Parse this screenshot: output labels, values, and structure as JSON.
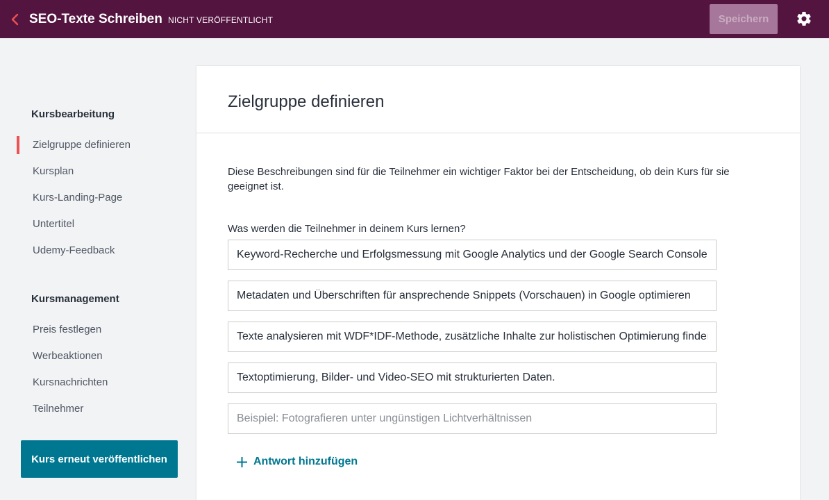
{
  "header": {
    "course_title": "SEO-Texte Schreiben",
    "status": "NICHT VERÖFFENTLICHT",
    "save_label": "Speichern",
    "icons": {
      "back": "chevron-left-icon",
      "settings": "gear-icon"
    },
    "colors": {
      "bar": "#541440",
      "back_arrow": "#ec5252"
    }
  },
  "sidebar": {
    "sections": [
      {
        "title": "Kursbearbeitung",
        "items": [
          {
            "label": "Zielgruppe definieren",
            "active": true
          },
          {
            "label": "Kursplan"
          },
          {
            "label": "Kurs-Landing-Page"
          },
          {
            "label": "Untertitel"
          },
          {
            "label": "Udemy-Feedback"
          }
        ]
      },
      {
        "title": "Kursmanagement",
        "items": [
          {
            "label": "Preis festlegen"
          },
          {
            "label": "Werbeaktionen"
          },
          {
            "label": "Kursnachrichten"
          },
          {
            "label": "Teilnehmer"
          }
        ]
      }
    ],
    "publish_label": "Kurs erneut veröffentlichen",
    "colors": {
      "active_indicator": "#ec5252",
      "publish_button": "#007791"
    }
  },
  "main": {
    "title": "Zielgruppe definieren",
    "description": "Diese Beschreibungen sind für die Teilnehmer ein wichtiger Faktor bei der Entscheidung, ob dein Kurs für sie geeignet ist.",
    "question": "Was werden die Teilnehmer in deinem Kurs lernen?",
    "answers": [
      {
        "value": "Keyword-Recherche und Erfolgsmessung mit Google Analytics und der Google Search Console"
      },
      {
        "value": "Metadaten und Überschriften für ansprechende Snippets (Vorschauen) in Google optimieren"
      },
      {
        "value": "Texte analysieren mit WDF*IDF-Methode, zusätzliche Inhalte zur holistischen Optimierung finden"
      },
      {
        "value": "Textoptimierung, Bilder- und Video-SEO mit strukturierten Daten."
      },
      {
        "value": "",
        "placeholder": "Beispiel: Fotografieren unter ungünstigen Lichtverhältnissen"
      }
    ],
    "add_answer_label": "Antwort hinzufügen",
    "icons": {
      "add": "plus-icon"
    },
    "colors": {
      "link": "#007791"
    }
  }
}
